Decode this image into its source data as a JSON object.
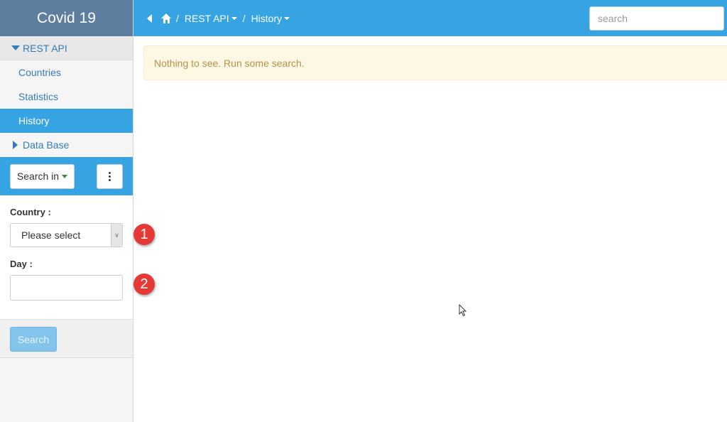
{
  "app": {
    "title": "Covid 19"
  },
  "sidebar": {
    "groups": [
      {
        "label": "REST API",
        "expanded": true,
        "items": [
          {
            "label": "Countries"
          },
          {
            "label": "Statistics"
          },
          {
            "label": "History",
            "active": true
          }
        ]
      },
      {
        "label": "Data Base",
        "expanded": false
      }
    ],
    "search_in_label": "Search in",
    "country_label": "Country :",
    "country_placeholder": "Please select",
    "day_label": "Day :",
    "day_value": "",
    "search_button": "Search"
  },
  "topbar": {
    "breadcrumb": [
      "REST API",
      "History"
    ],
    "separator": "/",
    "search_placeholder": "search"
  },
  "alert": {
    "text": "Nothing to see. Run some search."
  },
  "annotations": [
    "1",
    "2"
  ],
  "colors": {
    "brand": "#5d7e9e",
    "accent": "#36a3e3",
    "alert_bg": "#fcf8e3",
    "alert_text": "#b69148",
    "badge": "#e53935"
  }
}
